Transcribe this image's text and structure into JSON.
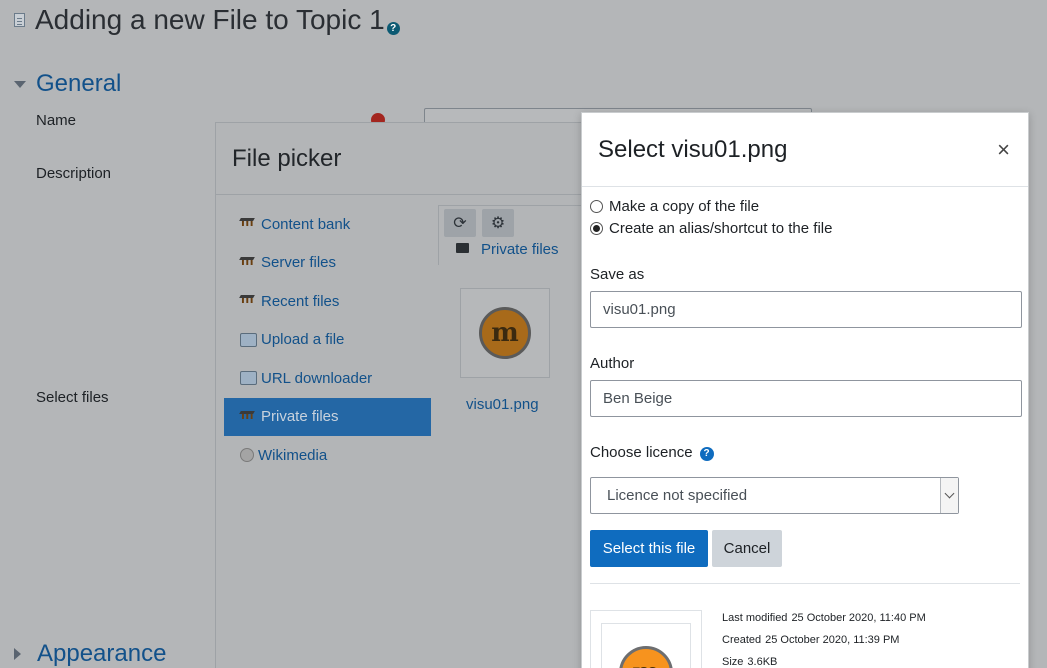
{
  "page": {
    "title": "Adding a new File to Topic 1",
    "help_glyph": "?",
    "sections": {
      "general": "General",
      "appearance": "Appearance"
    },
    "labels": {
      "name": "Name",
      "description": "Description",
      "select_files": "Select files"
    }
  },
  "file_picker": {
    "title": "File picker",
    "repositories": [
      {
        "label": "Content bank",
        "icon": "moodle-icon"
      },
      {
        "label": "Server files",
        "icon": "moodle-icon"
      },
      {
        "label": "Recent files",
        "icon": "moodle-icon"
      },
      {
        "label": "Upload a file",
        "icon": "upload-icon"
      },
      {
        "label": "URL downloader",
        "icon": "download-icon"
      },
      {
        "label": "Private files",
        "icon": "moodle-icon",
        "active": true
      },
      {
        "label": "Wikimedia",
        "icon": "globe-icon"
      }
    ],
    "toolbar": {
      "refresh_glyph": "⟳",
      "settings_glyph": "⚙"
    },
    "path": "Private files",
    "file": {
      "name": "visu01.png",
      "badge_glyph": "m"
    }
  },
  "modal": {
    "title": "Select visu01.png",
    "close_glyph": "×",
    "radio_copy": "Make a copy of the file",
    "radio_alias": "Create an alias/shortcut to the file",
    "save_as_label": "Save as",
    "save_as_value": "visu01.png",
    "author_label": "Author",
    "author_value": "Ben Beige",
    "licence_label": "Choose licence",
    "licence_value": "Licence not specified",
    "select_button": "Select this file",
    "cancel_button": "Cancel",
    "preview_badge_glyph": "m",
    "meta": {
      "last_modified_label": "Last modified",
      "last_modified_value": "25 October 2020, 11:40 PM",
      "created_label": "Created",
      "created_value": "25 October 2020, 11:39 PM",
      "size_label": "Size",
      "size_value": "3.6KB"
    }
  },
  "colors": {
    "primary": "#0f6cbf",
    "link": "#12518a",
    "active_nav": "#2467a5",
    "overlay": "#b4b6b8"
  }
}
